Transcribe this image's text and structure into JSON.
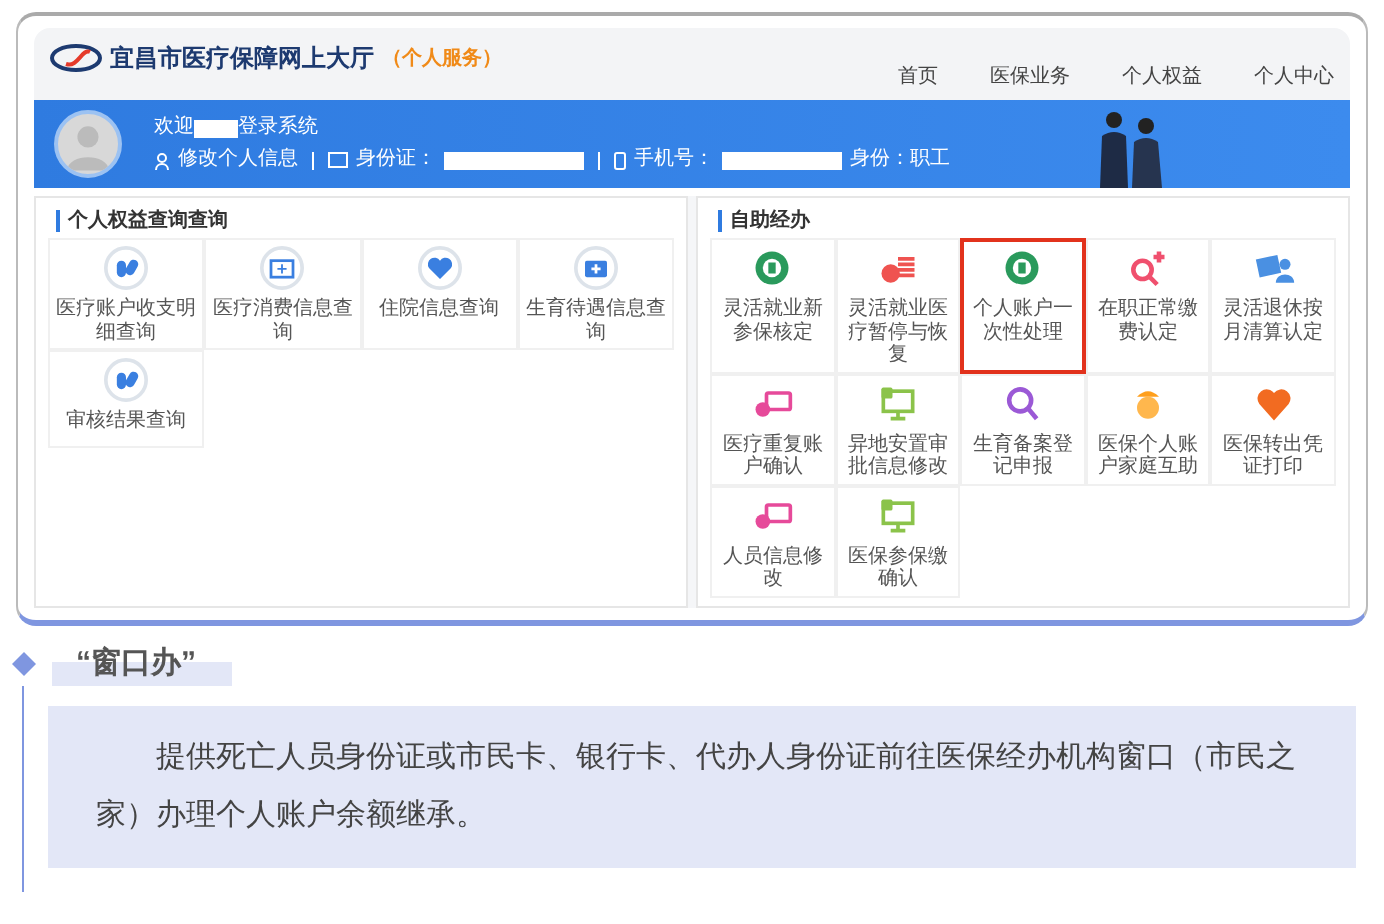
{
  "header": {
    "site_title": "宜昌市医疗保障网上大厅",
    "site_subtitle": "（个人服务）",
    "nav": [
      "首页",
      "医保业务",
      "个人权益",
      "个人中心"
    ]
  },
  "banner": {
    "welcome_prefix": "欢迎",
    "welcome_suffix": "登录系统",
    "edit_profile": "修改个人信息",
    "id_label": "身份证：",
    "phone_label": "手机号：",
    "identity": "身份：职工"
  },
  "panels": [
    {
      "title": "个人权益查询查询",
      "tiles": [
        {
          "label": "医疗账户收支明细查询"
        },
        {
          "label": "医疗消费信息查询"
        },
        {
          "label": "住院信息查询"
        },
        {
          "label": "生育待遇信息查询"
        },
        {
          "label": "审核结果查询"
        }
      ]
    },
    {
      "title": "自助经办",
      "tiles": [
        {
          "label": "灵活就业新参保核定",
          "highlighted": false
        },
        {
          "label": "灵活就业医疗暂停与恢复",
          "highlighted": false
        },
        {
          "label": "个人账户一次性处理",
          "highlighted": true
        },
        {
          "label": "在职正常缴费认定",
          "highlighted": false
        },
        {
          "label": "灵活退休按月清算认定",
          "highlighted": false
        },
        {
          "label": "医疗重复账户确认",
          "highlighted": false
        },
        {
          "label": "异地安置审批信息修改",
          "highlighted": false
        },
        {
          "label": "生育备案登记申报",
          "highlighted": false
        },
        {
          "label": "医保个人账户家庭互助",
          "highlighted": false
        },
        {
          "label": "医保转出凭证打印",
          "highlighted": false
        },
        {
          "label": "人员信息修改",
          "highlighted": false
        },
        {
          "label": "医保参保缴确认",
          "highlighted": false
        }
      ]
    }
  ],
  "section": {
    "heading": "“窗口办”",
    "body": "提供死亡人员身份证或市民卡、银行卡、代办人身份证前往医保经办机构窗口（市民之家）办理个人账户余额继承。"
  }
}
